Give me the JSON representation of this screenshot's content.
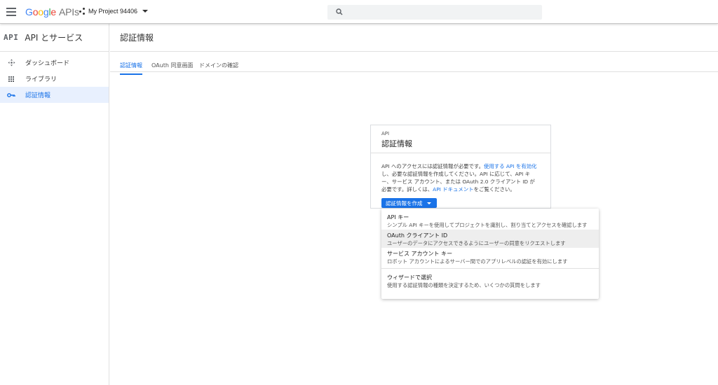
{
  "header": {
    "logo_google_letters": [
      "G",
      "o",
      "o",
      "g",
      "l",
      "e"
    ],
    "logo_suffix": "APIs",
    "project_name": "My Project 94406",
    "search_placeholder": ""
  },
  "sidebar": {
    "logo": "API",
    "title": "API とサービス",
    "items": [
      {
        "label": "ダッシュボード",
        "icon": "dashboard-icon"
      },
      {
        "label": "ライブラリ",
        "icon": "library-icon"
      },
      {
        "label": "認証情報",
        "icon": "key-icon",
        "active": true
      }
    ]
  },
  "main": {
    "title": "認証情報",
    "tabs": [
      {
        "label": "認証情報",
        "active": true
      },
      {
        "label": "OAuth 同意画面"
      },
      {
        "label": "ドメインの確認"
      }
    ]
  },
  "card": {
    "subtitle": "API",
    "title": "認証情報",
    "body_part1": "API へのアクセスには認証情報が必要です。",
    "link1": "使用する API を有効化",
    "body_part2": "し、必要な認証情報を作成してください。API に応じて、API キー、サービス アカウント、または OAuth 2.0 クライアント ID が必要です。詳しくは、",
    "link2": "API ドキュメント",
    "body_part3": "をご覧ください。",
    "button_label": "認証情報を作成"
  },
  "menu": {
    "items": [
      {
        "title": "API キー",
        "desc": "シンプル API キーを使用してプロジェクトを識別し、割り当てとアクセスを確認します"
      },
      {
        "title": "OAuth クライアント ID",
        "desc": "ユーザーのデータにアクセスできるようにユーザーの同意をリクエストします",
        "hover": true
      },
      {
        "title": "サービス アカウント キー",
        "desc": "ロボット アカウントによるサーバー間でのアプリレベルの認証を有効にします"
      },
      {
        "title": "ウィザードで選択",
        "desc": "使用する認証情報の種類を決定するため、いくつかの質問をします"
      }
    ]
  }
}
